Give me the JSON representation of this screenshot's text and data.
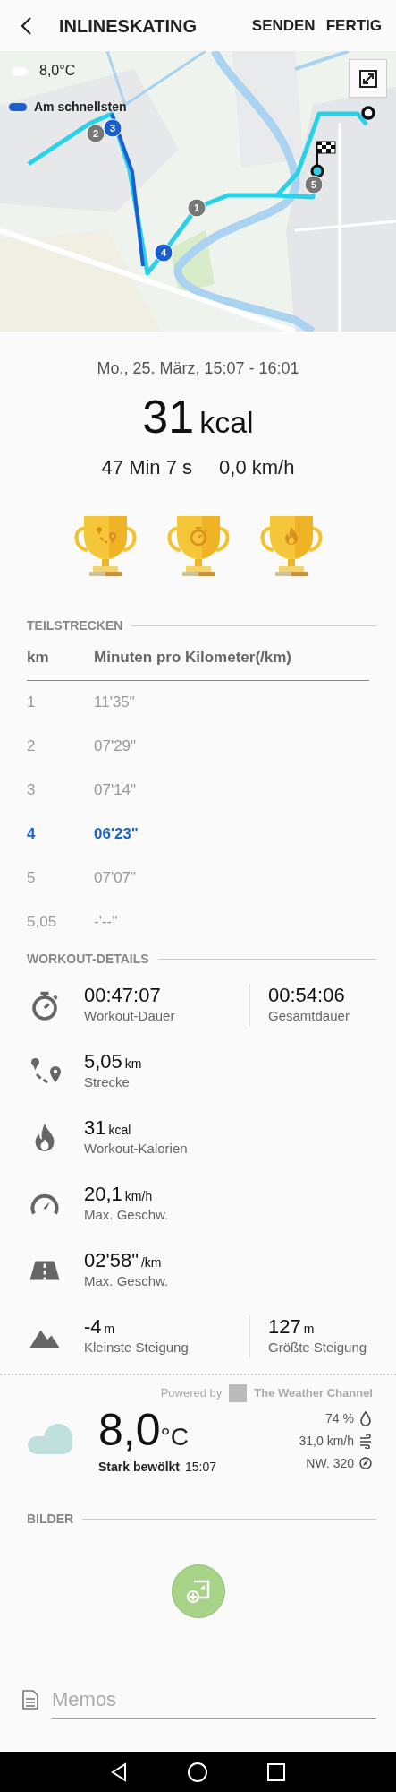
{
  "header": {
    "title": "INLINESKATING",
    "actions": [
      "SENDEN",
      "FERTIG"
    ]
  },
  "map": {
    "temperature": "8,0°C",
    "legend": "Am schnellsten",
    "markers": [
      {
        "label": "1",
        "fastest": false
      },
      {
        "label": "2",
        "fastest": false
      },
      {
        "label": "3",
        "fastest": true
      },
      {
        "label": "4",
        "fastest": true
      },
      {
        "label": "5",
        "fastest": false
      }
    ]
  },
  "summary": {
    "date": "Mo., 25. März, 15:07 - 16:01",
    "calories": "31",
    "calories_unit": "kcal",
    "duration": "47 Min 7 s",
    "speed": "0,0 km/h"
  },
  "trophies": [
    {
      "kind": "route"
    },
    {
      "kind": "stopwatch"
    },
    {
      "kind": "flame"
    }
  ],
  "splits": {
    "title": "TEILSTRECKEN",
    "columns": [
      "km",
      "Minuten pro Kilometer(/km)"
    ],
    "rows": [
      {
        "km": "1",
        "pace": "11'35\"",
        "selected": false
      },
      {
        "km": "2",
        "pace": "07'29\"",
        "selected": false
      },
      {
        "km": "3",
        "pace": "07'14\"",
        "selected": false
      },
      {
        "km": "4",
        "pace": "06'23\"",
        "selected": true
      },
      {
        "km": "5",
        "pace": "07'07\"",
        "selected": false
      },
      {
        "km": "5,05",
        "pace": "-'--\"",
        "selected": false
      }
    ]
  },
  "details": {
    "title": "WORKOUT-DETAILS",
    "rows": [
      {
        "kind": "stopwatch",
        "value": "00:47:07",
        "label": "Workout-Dauer",
        "second": {
          "value": "00:54:06",
          "label": "Gesamtdauer"
        }
      },
      {
        "kind": "route",
        "value": "5,05",
        "unit": "km",
        "label": "Strecke"
      },
      {
        "kind": "flame",
        "value": "31",
        "unit": "kcal",
        "label": "Workout-Kalorien"
      },
      {
        "kind": "speedometer",
        "value": "20,1",
        "unit": "km/h",
        "label": "Max. Geschw."
      },
      {
        "kind": "road",
        "value": "02'58\"",
        "unit": "/km",
        "label": "Max. Geschw."
      },
      {
        "kind": "mountain",
        "value": "-4",
        "unit": "m",
        "label": "Kleinste Steigung",
        "second": {
          "value": "127",
          "unit": "m",
          "label": "Größte Steigung"
        }
      }
    ]
  },
  "weather": {
    "powered_by": "Powered by",
    "provider": "The Weather Channel",
    "temperature": "8,0",
    "unit": "°C",
    "condition": "Stark bewölkt",
    "time": "15:07",
    "humidity": "74 %",
    "wind": "31,0 km/h",
    "direction": "NW. 320"
  },
  "pictures": {
    "title": "BILDER"
  },
  "memo": {
    "placeholder": "Memos"
  }
}
